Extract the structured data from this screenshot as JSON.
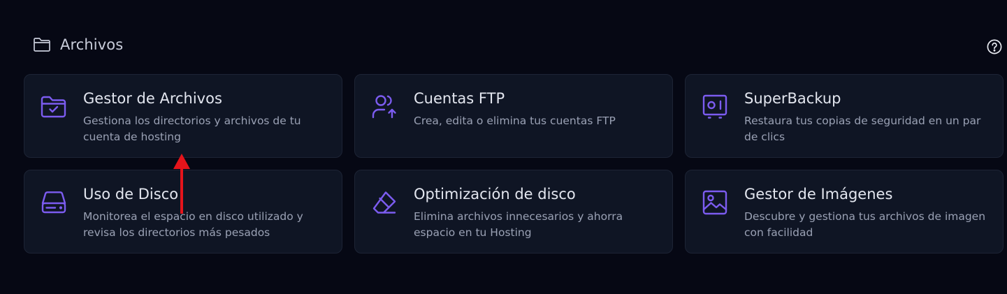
{
  "section": {
    "title": "Archivos",
    "icon": "folder-icon"
  },
  "help": {
    "icon": "help-circle-icon"
  },
  "colors": {
    "background": "#060814",
    "card_background": "#0f1524",
    "card_border": "#1d2435",
    "icon_accent": "#7c5cf0",
    "title_text": "#e3e6ef",
    "description_text": "#9aa1b4",
    "annotation_arrow": "#e5141b"
  },
  "cards": [
    {
      "title": "Gestor de Archivos",
      "description": "Gestiona los directorios y archivos de tu cuenta de hosting",
      "icon": "folder-check-icon"
    },
    {
      "title": "Cuentas FTP",
      "description": "Crea, edita o elimina tus cuentas FTP",
      "icon": "user-upload-icon"
    },
    {
      "title": "SuperBackup",
      "description": "Restaura tus copias de seguridad en un par de clics",
      "icon": "backup-safe-icon"
    },
    {
      "title": "Uso de Disco",
      "description": "Monitorea el espacio en disco utilizado y revisa los directorios más pesados",
      "icon": "hard-drive-icon"
    },
    {
      "title": "Optimización de disco",
      "description": "Elimina archivos innecesarios y ahorra espacio en tu Hosting",
      "icon": "eraser-icon"
    },
    {
      "title": "Gestor de Imágenes",
      "description": "Descubre y gestiona tus archivos de imagen con facilidad",
      "icon": "image-icon"
    }
  ],
  "annotation": {
    "icon": "red-arrow-up-icon"
  }
}
